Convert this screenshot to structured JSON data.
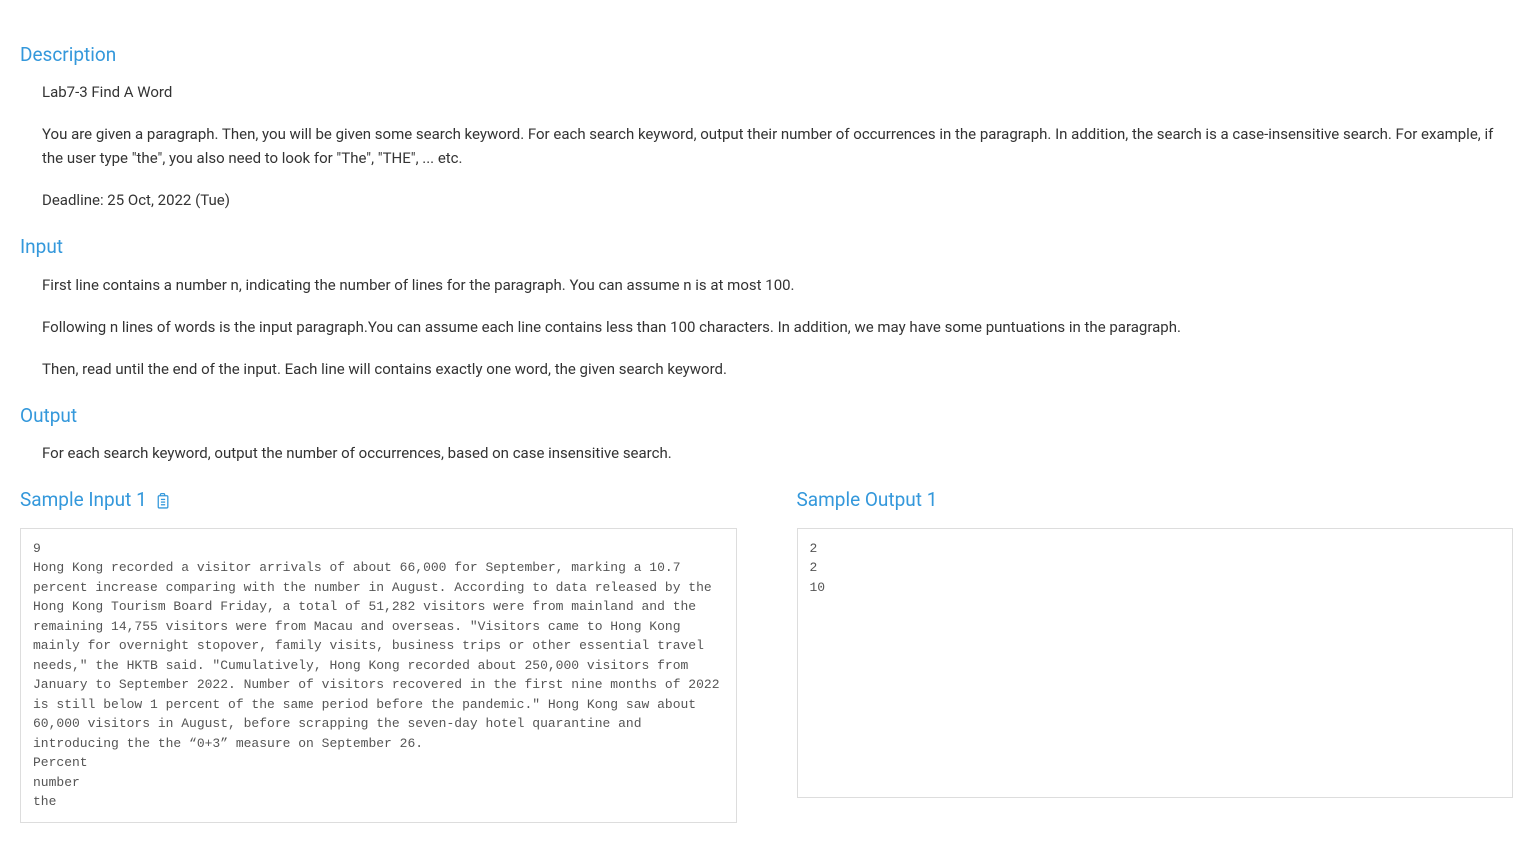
{
  "sections": {
    "description": {
      "heading": "Description",
      "p1": "Lab7-3 Find A Word",
      "p2": "You are given a paragraph. Then, you will be given some search keyword. For each search keyword, output their number of occurrences in the paragraph. In addition, the search is a case-insensitive search. For example, if the user type \"the\", you also need to look for \"The\", \"THE\", ... etc.",
      "p3": "Deadline: 25 Oct, 2022 (Tue)"
    },
    "input": {
      "heading": "Input",
      "p1": "First line contains a number n, indicating the number of lines for the paragraph. You can assume n is at most 100.",
      "p2": "Following n lines of words is the input paragraph.You can assume each line contains less than 100 characters. In addition, we may have some puntuations in the paragraph.",
      "p3": "Then, read until the end of the input. Each line will contains exactly one word, the given search keyword."
    },
    "output": {
      "heading": "Output",
      "p1": "For each search keyword, output the number of occurrences, based on case insensitive search."
    }
  },
  "samples": {
    "input": {
      "heading": "Sample Input 1",
      "content": "9\nHong Kong recorded a visitor arrivals of about 66,000 for September, marking a 10.7 percent increase comparing with the number in August. According to data released by the Hong Kong Tourism Board Friday, a total of 51,282 visitors were from mainland and the remaining 14,755 visitors were from Macau and overseas. \"Visitors came to Hong Kong mainly for overnight stopover, family visits, business trips or other essential travel needs,\" the HKTB said. \"Cumulatively, Hong Kong recorded about 250,000 visitors from January to September 2022. Number of visitors recovered in the first nine months of 2022 is still below 1 percent of the same period before the pandemic.\" Hong Kong saw about 60,000 visitors in August, before scrapping the seven-day hotel quarantine and introducing the the “0+3” measure on September 26.\nPercent\nnumber\nthe"
    },
    "output": {
      "heading": "Sample Output 1",
      "content": "2\n2\n10"
    }
  }
}
